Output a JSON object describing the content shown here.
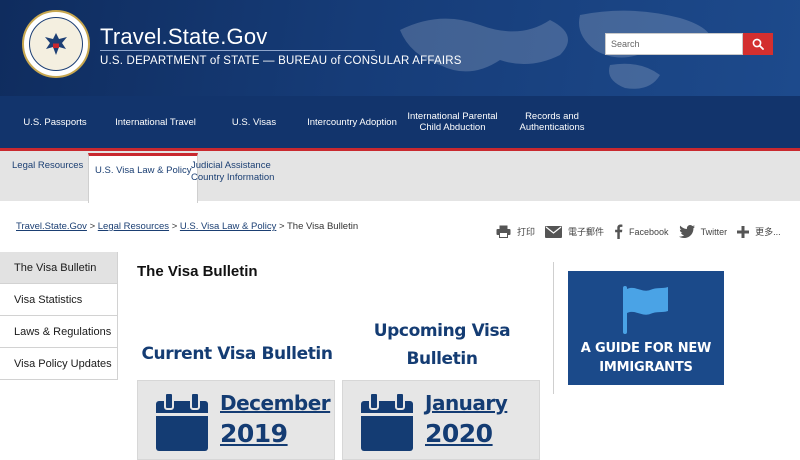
{
  "header": {
    "site_title": "Travel.State.Gov",
    "site_subtitle": "U.S. DEPARTMENT of STATE — BUREAU of CONSULAR AFFAIRS",
    "search_placeholder": "Search",
    "search_icon": "search-icon"
  },
  "nav": {
    "items": [
      "U.S. Passports",
      "International Travel",
      "U.S. Visas",
      "Intercountry Adoption",
      [
        "International Parental",
        "Child Abduction"
      ],
      [
        "Records and",
        "Authentications"
      ]
    ]
  },
  "subnav": {
    "tabs": [
      {
        "lines": [
          "Legal Resources"
        ],
        "active": false
      },
      {
        "lines": [
          "U.S. Visa Law & Policy"
        ],
        "active": true
      },
      {
        "lines": [
          "Judicial Assistance",
          "Country Information"
        ],
        "active": false
      }
    ]
  },
  "breadcrumb": {
    "links": [
      "Travel.State.Gov",
      "Legal Resources",
      "U.S. Visa Law & Policy"
    ],
    "separator": " > ",
    "current": "The Visa Bulletin"
  },
  "share": {
    "print": "打印",
    "email": "電子郵件",
    "facebook": "Facebook",
    "twitter": "Twitter",
    "more": "更多..."
  },
  "sidebar": {
    "items": [
      {
        "label": "The Visa Bulletin",
        "active": true
      },
      {
        "label": "Visa Statistics",
        "active": false
      },
      {
        "label": "Laws & Regulations",
        "active": false
      },
      {
        "label": "Visa Policy Updates",
        "active": false
      }
    ]
  },
  "content": {
    "page_title": "The Visa Bulletin",
    "current_heading": "Current Visa Bulletin",
    "upcoming_heading_lines": [
      "Upcoming Visa",
      "Bulletin"
    ],
    "current_month": "December",
    "current_year": "2019",
    "upcoming_month": "January",
    "upcoming_year": "2020"
  },
  "guide": {
    "lines": [
      "A GUIDE FOR NEW",
      "IMMIGRANTS"
    ],
    "icon": "flag-icon"
  },
  "colors": {
    "header_bg": "#163c78",
    "nav_bg": "#12346c",
    "accent_red": "#c9292f",
    "brand_blue": "#143c73",
    "guide_bg": "#1b4a8a"
  }
}
